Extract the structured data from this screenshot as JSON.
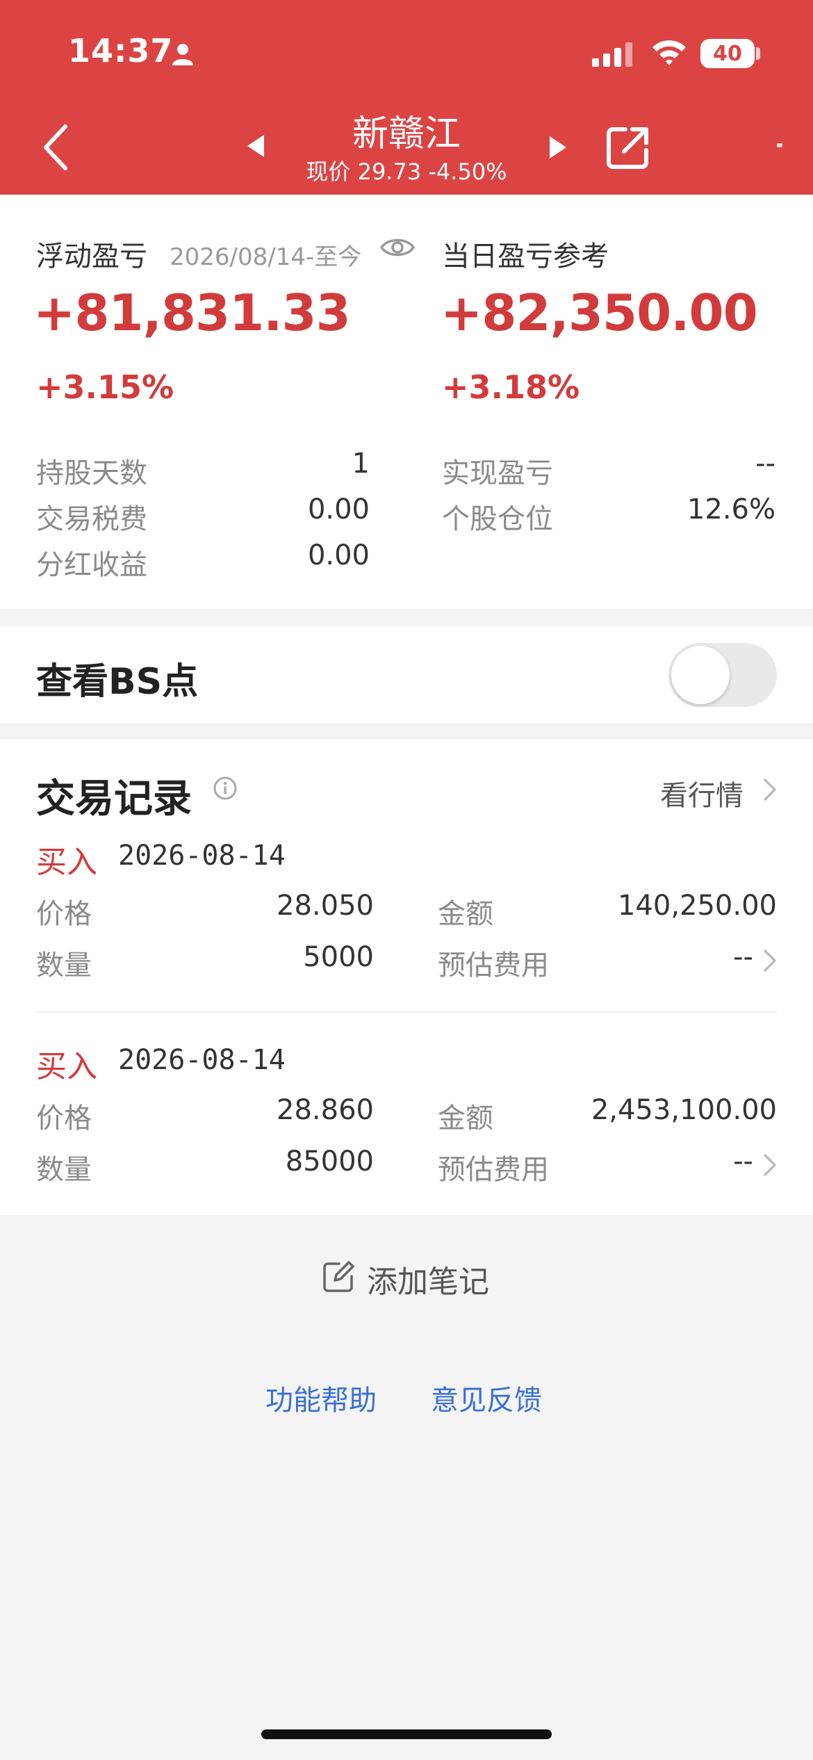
{
  "status_bar": {
    "time": "14:37",
    "battery": "40"
  },
  "header": {
    "stock_name": "新赣江",
    "price_line": "现价 29.73 -4.50%"
  },
  "summary": {
    "floating_label": "浮动盈亏",
    "floating_period": "2026/08/14-至今",
    "floating_value": "+81,831.33",
    "floating_pct": "+3.15%",
    "daily_label": "当日盈亏参考",
    "daily_value": "+82,350.00",
    "daily_pct": "+3.18%",
    "stats_left": [
      {
        "label": "持股天数",
        "value": "1"
      },
      {
        "label": "交易税费",
        "value": "0.00"
      },
      {
        "label": "分红收益",
        "value": "0.00"
      }
    ],
    "stats_right": [
      {
        "label": "实现盈亏",
        "value": "--"
      },
      {
        "label": "个股仓位",
        "value": "12.6%"
      }
    ]
  },
  "bs": {
    "label": "查看BS点",
    "enabled": false
  },
  "trades": {
    "title": "交易记录",
    "market_link": "看行情",
    "records": [
      {
        "type": "买入",
        "date": "2026-08-14",
        "price_label": "价格",
        "price": "28.050",
        "amount_label": "金额",
        "amount": "140,250.00",
        "qty_label": "数量",
        "qty": "5000",
        "fee_label": "预估费用",
        "fee": "--"
      },
      {
        "type": "买入",
        "date": "2026-08-14",
        "price_label": "价格",
        "price": "28.860",
        "amount_label": "金额",
        "amount": "2,453,100.00",
        "qty_label": "数量",
        "qty": "85000",
        "fee_label": "预估费用",
        "fee": "--"
      }
    ]
  },
  "footer": {
    "add_note": "添加笔记",
    "help": "功能帮助",
    "feedback": "意见反馈"
  },
  "colors": {
    "header": "#dc4444",
    "profit": "#d23b3b",
    "link": "#3a6fd6"
  }
}
